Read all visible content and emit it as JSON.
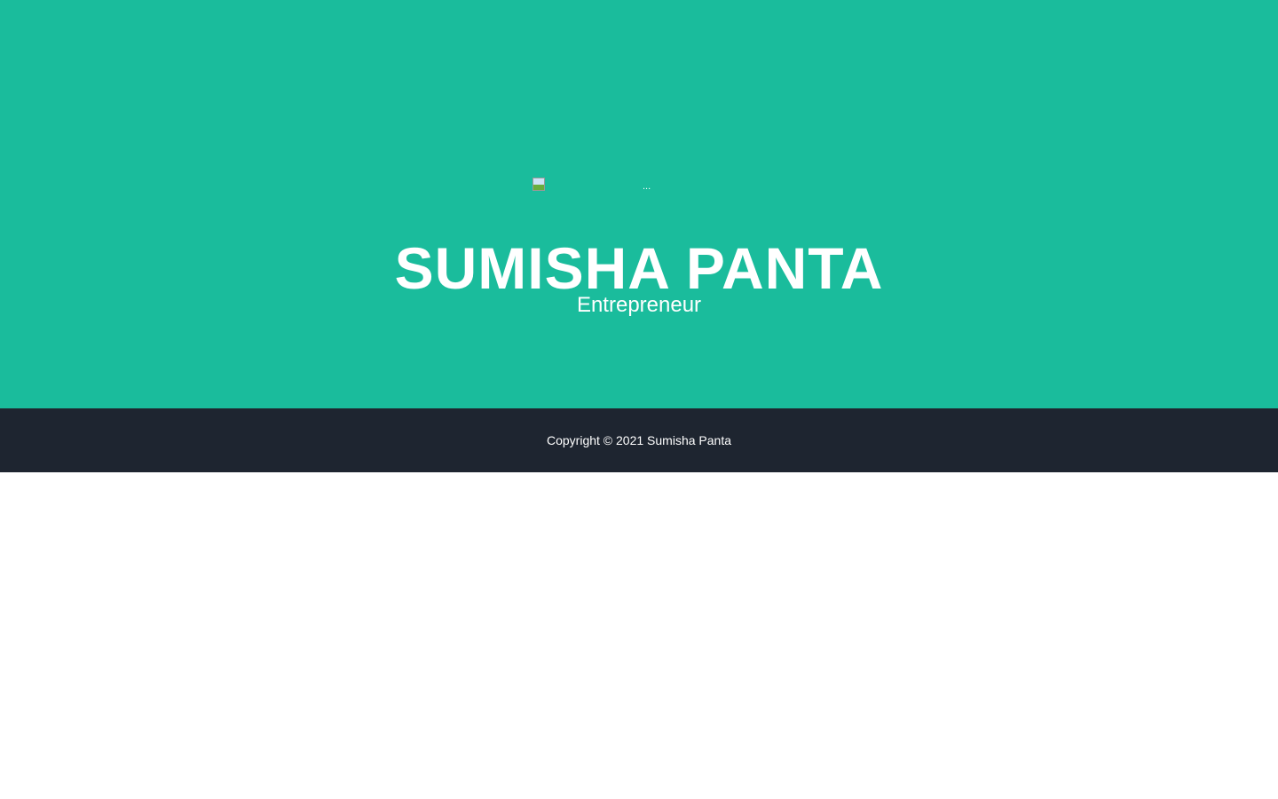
{
  "hero": {
    "image_alt": "...",
    "name": "SUMISHA PANTA",
    "role": "Entrepreneur"
  },
  "footer": {
    "copyright": "Copyright © 2021 Sumisha Panta"
  },
  "colors": {
    "hero_bg": "#1abc9c",
    "footer_bg": "#1e2530"
  }
}
